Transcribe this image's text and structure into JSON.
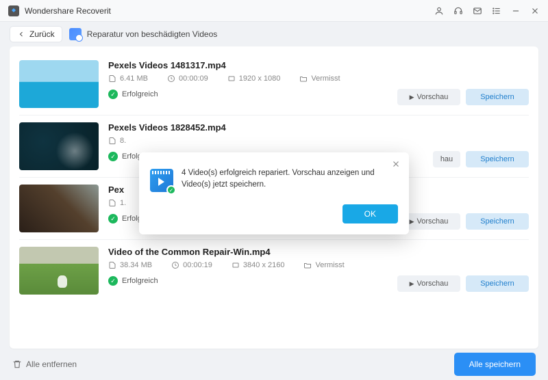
{
  "app": {
    "title": "Wondershare Recoverit"
  },
  "toolbar": {
    "back_label": "Zurück",
    "page_label": "Reparatur von beschädigten Videos"
  },
  "buttons": {
    "preview": "Vorschau",
    "save": "Speichern",
    "remove_all": "Alle entfernen",
    "save_all": "Alle speichern"
  },
  "status": {
    "success": "Erfolgreich",
    "missing": "Vermisst"
  },
  "videos": [
    {
      "title": "Pexels Videos 1481317.mp4",
      "size": "6.41  MB",
      "duration": "00:00:09",
      "resolution": "1920 x 1080"
    },
    {
      "title": "Pexels Videos 1828452.mp4",
      "size": "8.",
      "duration": "",
      "resolution": ""
    },
    {
      "title": "Pex",
      "size": "1.",
      "duration": "",
      "resolution": ""
    },
    {
      "title": "Video of the Common Repair-Win.mp4",
      "size": "38.34  MB",
      "duration": "00:00:19",
      "resolution": "3840 x 2160"
    }
  ],
  "modal": {
    "message": "4 Video(s) erfolgreich repariert. Vorschau anzeigen und Video(s) jetzt speichern.",
    "ok": "OK"
  }
}
